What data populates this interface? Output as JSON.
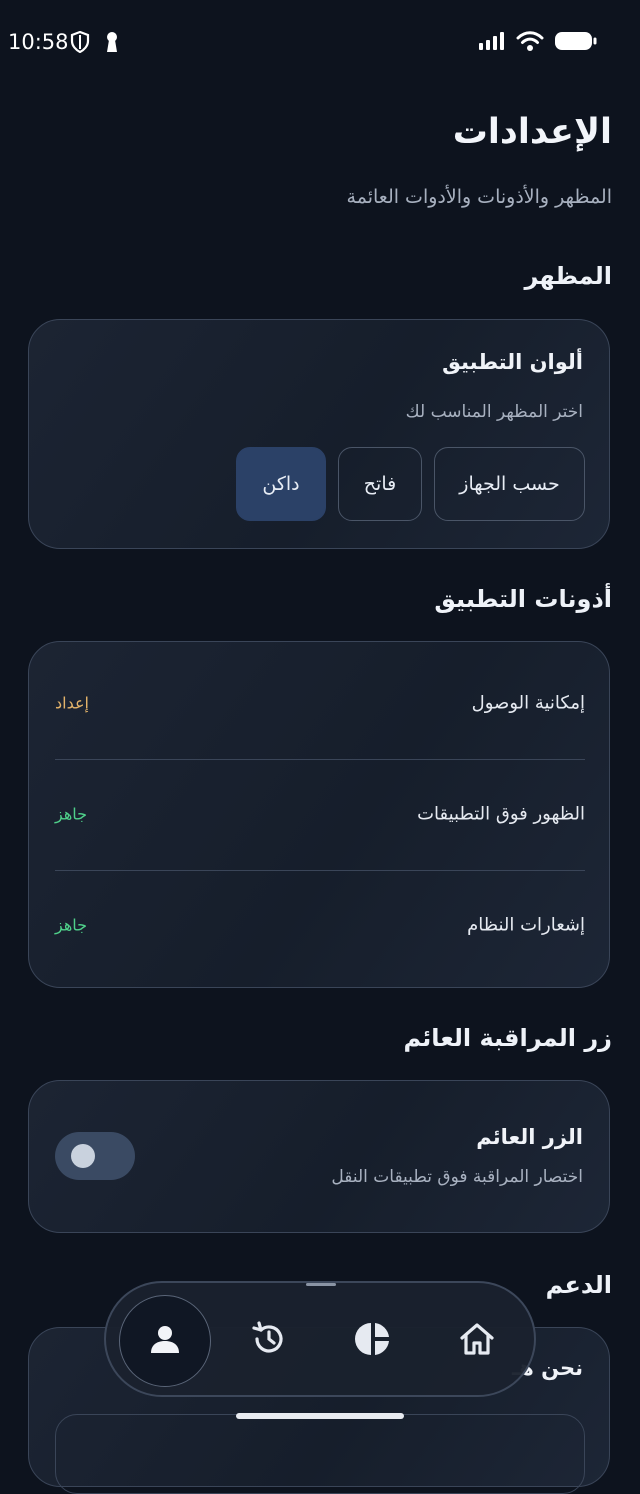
{
  "status_bar": {
    "time": "10:58"
  },
  "header": {
    "title": "الإعدادات",
    "subtitle": "المظهر والأذونات والأدوات العائمة"
  },
  "appearance": {
    "section_title": "المظهر",
    "card_title": "ألوان التطبيق",
    "card_subtitle": "اختر المظهر المناسب لك",
    "options": [
      "حسب الجهاز",
      "فاتح",
      "داكن"
    ],
    "selected": "داكن",
    "accent_color": "#2b4167"
  },
  "permissions": {
    "section_title": "أذونات التطبيق",
    "items": [
      {
        "label": "إمكانية الوصول",
        "status": "إعداد",
        "status_color": "#e3b36a"
      },
      {
        "label": "الظهور فوق التطبيقات",
        "status": "جاهز",
        "status_color": "#4fd08a"
      },
      {
        "label": "إشعارات النظام",
        "status": "جاهز",
        "status_color": "#4fd08a"
      }
    ]
  },
  "floating": {
    "section_title": "زر المراقبة العائم",
    "card_title": "الزر العائم",
    "card_subtitle": "اختصار المراقبة فوق تطبيقات النقل",
    "toggle_on": false
  },
  "support": {
    "section_title": "الدعم",
    "card_title_partial": "نحن هـ"
  },
  "bottom_nav": {
    "items": [
      {
        "icon": "profile-icon",
        "active": true
      },
      {
        "icon": "history-icon",
        "active": false
      },
      {
        "icon": "pie-chart-icon",
        "active": false
      },
      {
        "icon": "home-icon",
        "active": false
      }
    ]
  }
}
